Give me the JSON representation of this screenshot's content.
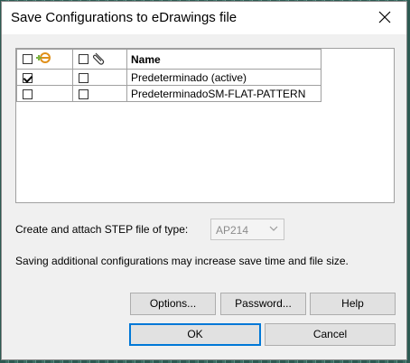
{
  "dialog": {
    "title": "Save Configurations to eDrawings file"
  },
  "table": {
    "headers": {
      "name": "Name"
    },
    "rows": [
      {
        "checked_export": true,
        "checked_attach": false,
        "name": "Predeterminado (active)"
      },
      {
        "checked_export": false,
        "checked_attach": false,
        "name": "PredeterminadoSM-FLAT-PATTERN"
      }
    ]
  },
  "step": {
    "label": "Create and attach STEP file of type:",
    "selected": "AP214"
  },
  "warning": "Saving additional configurations may increase save time and file size.",
  "buttons": {
    "options": "Options...",
    "password": "Password...",
    "help": "Help",
    "ok": "OK",
    "cancel": "Cancel"
  },
  "colors": {
    "accent": "#0078d7",
    "edrawings_green": "#7bb241",
    "edrawings_orange": "#e0901a"
  },
  "icons": [
    "close-icon",
    "edrawings-icon",
    "paperclip-icon",
    "chevron-down-icon"
  ]
}
